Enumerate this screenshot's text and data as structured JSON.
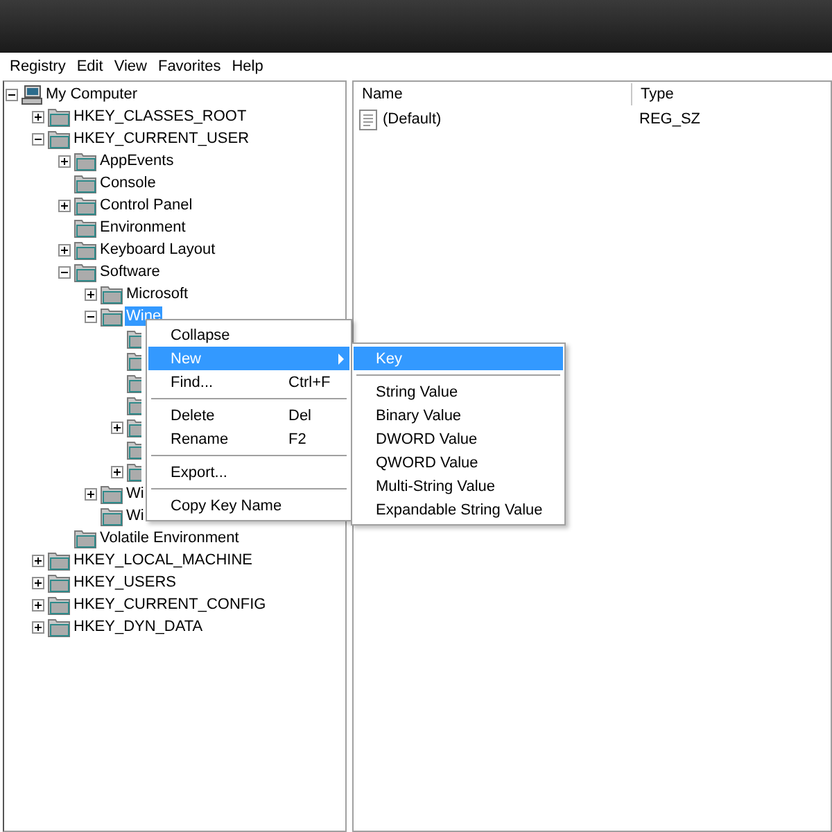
{
  "menubar": [
    {
      "label": "Registry"
    },
    {
      "label": "Edit"
    },
    {
      "label": "View"
    },
    {
      "label": "Favorites"
    },
    {
      "label": "Help"
    }
  ],
  "tree": {
    "label": "My Computer",
    "kind": "computer",
    "expanded": true,
    "selected": false,
    "children": [
      {
        "label": "HKEY_CLASSES_ROOT",
        "kind": "branch",
        "expanded": false,
        "selected": false
      },
      {
        "label": "HKEY_CURRENT_USER",
        "kind": "branch",
        "expanded": true,
        "selected": false,
        "children": [
          {
            "label": "AppEvents",
            "kind": "branch",
            "expanded": false,
            "selected": false
          },
          {
            "label": "Console",
            "kind": "leaf",
            "selected": false
          },
          {
            "label": "Control Panel",
            "kind": "branch",
            "expanded": false,
            "selected": false
          },
          {
            "label": "Environment",
            "kind": "leaf",
            "selected": false
          },
          {
            "label": "Keyboard Layout",
            "kind": "branch",
            "expanded": false,
            "selected": false
          },
          {
            "label": "Software",
            "kind": "branch",
            "expanded": true,
            "selected": false,
            "children": [
              {
                "label": "Microsoft",
                "kind": "branch",
                "expanded": false,
                "selected": false
              },
              {
                "label": "Wine",
                "kind": "branch",
                "expanded": true,
                "selected": true,
                "children": [
                  {
                    "kind": "leaf"
                  },
                  {
                    "kind": "leaf"
                  },
                  {
                    "kind": "leaf"
                  },
                  {
                    "kind": "leaf"
                  },
                  {
                    "kind": "branch",
                    "expanded": false
                  },
                  {
                    "kind": "leaf"
                  },
                  {
                    "kind": "branch",
                    "expanded": false
                  }
                ]
              },
              {
                "label": "Wi",
                "kind": "branch",
                "expanded": false,
                "selected": false
              },
              {
                "label": "Wi",
                "kind": "leaf",
                "selected": false
              }
            ]
          },
          {
            "label": "Volatile Environment",
            "kind": "leaf",
            "selected": false
          }
        ]
      },
      {
        "label": "HKEY_LOCAL_MACHINE",
        "kind": "branch",
        "expanded": false,
        "selected": false
      },
      {
        "label": "HKEY_USERS",
        "kind": "branch",
        "expanded": false,
        "selected": false
      },
      {
        "label": "HKEY_CURRENT_CONFIG",
        "kind": "branch",
        "expanded": false,
        "selected": false
      },
      {
        "label": "HKEY_DYN_DATA",
        "kind": "branch",
        "expanded": false,
        "selected": false
      }
    ]
  },
  "list": {
    "columns": [
      "Name",
      "Type"
    ],
    "rows": [
      {
        "name": "(Default)",
        "type": "REG_SZ"
      }
    ]
  },
  "context_menu": {
    "items": [
      {
        "kind": "item",
        "label": "Collapse",
        "selected": false
      },
      {
        "kind": "submenu",
        "label": "New",
        "selected": true
      },
      {
        "kind": "item",
        "label": "Find...",
        "shortcut": "Ctrl+F",
        "selected": false
      },
      {
        "kind": "separator"
      },
      {
        "kind": "item",
        "label": "Delete",
        "shortcut": "Del",
        "selected": false
      },
      {
        "kind": "item",
        "label": "Rename",
        "shortcut": "F2",
        "selected": false
      },
      {
        "kind": "separator"
      },
      {
        "kind": "item",
        "label": "Export...",
        "selected": false
      },
      {
        "kind": "separator"
      },
      {
        "kind": "item",
        "label": "Copy Key Name",
        "selected": false
      }
    ]
  },
  "submenu": {
    "items": [
      {
        "kind": "item",
        "label": "Key",
        "selected": true
      },
      {
        "kind": "separator"
      },
      {
        "kind": "item",
        "label": "String Value",
        "selected": false
      },
      {
        "kind": "item",
        "label": "Binary Value",
        "selected": false
      },
      {
        "kind": "item",
        "label": "DWORD Value",
        "selected": false
      },
      {
        "kind": "item",
        "label": "QWORD Value",
        "selected": false
      },
      {
        "kind": "item",
        "label": "Multi-String Value",
        "selected": false
      },
      {
        "kind": "item",
        "label": "Expandable String Value",
        "selected": false
      }
    ]
  }
}
